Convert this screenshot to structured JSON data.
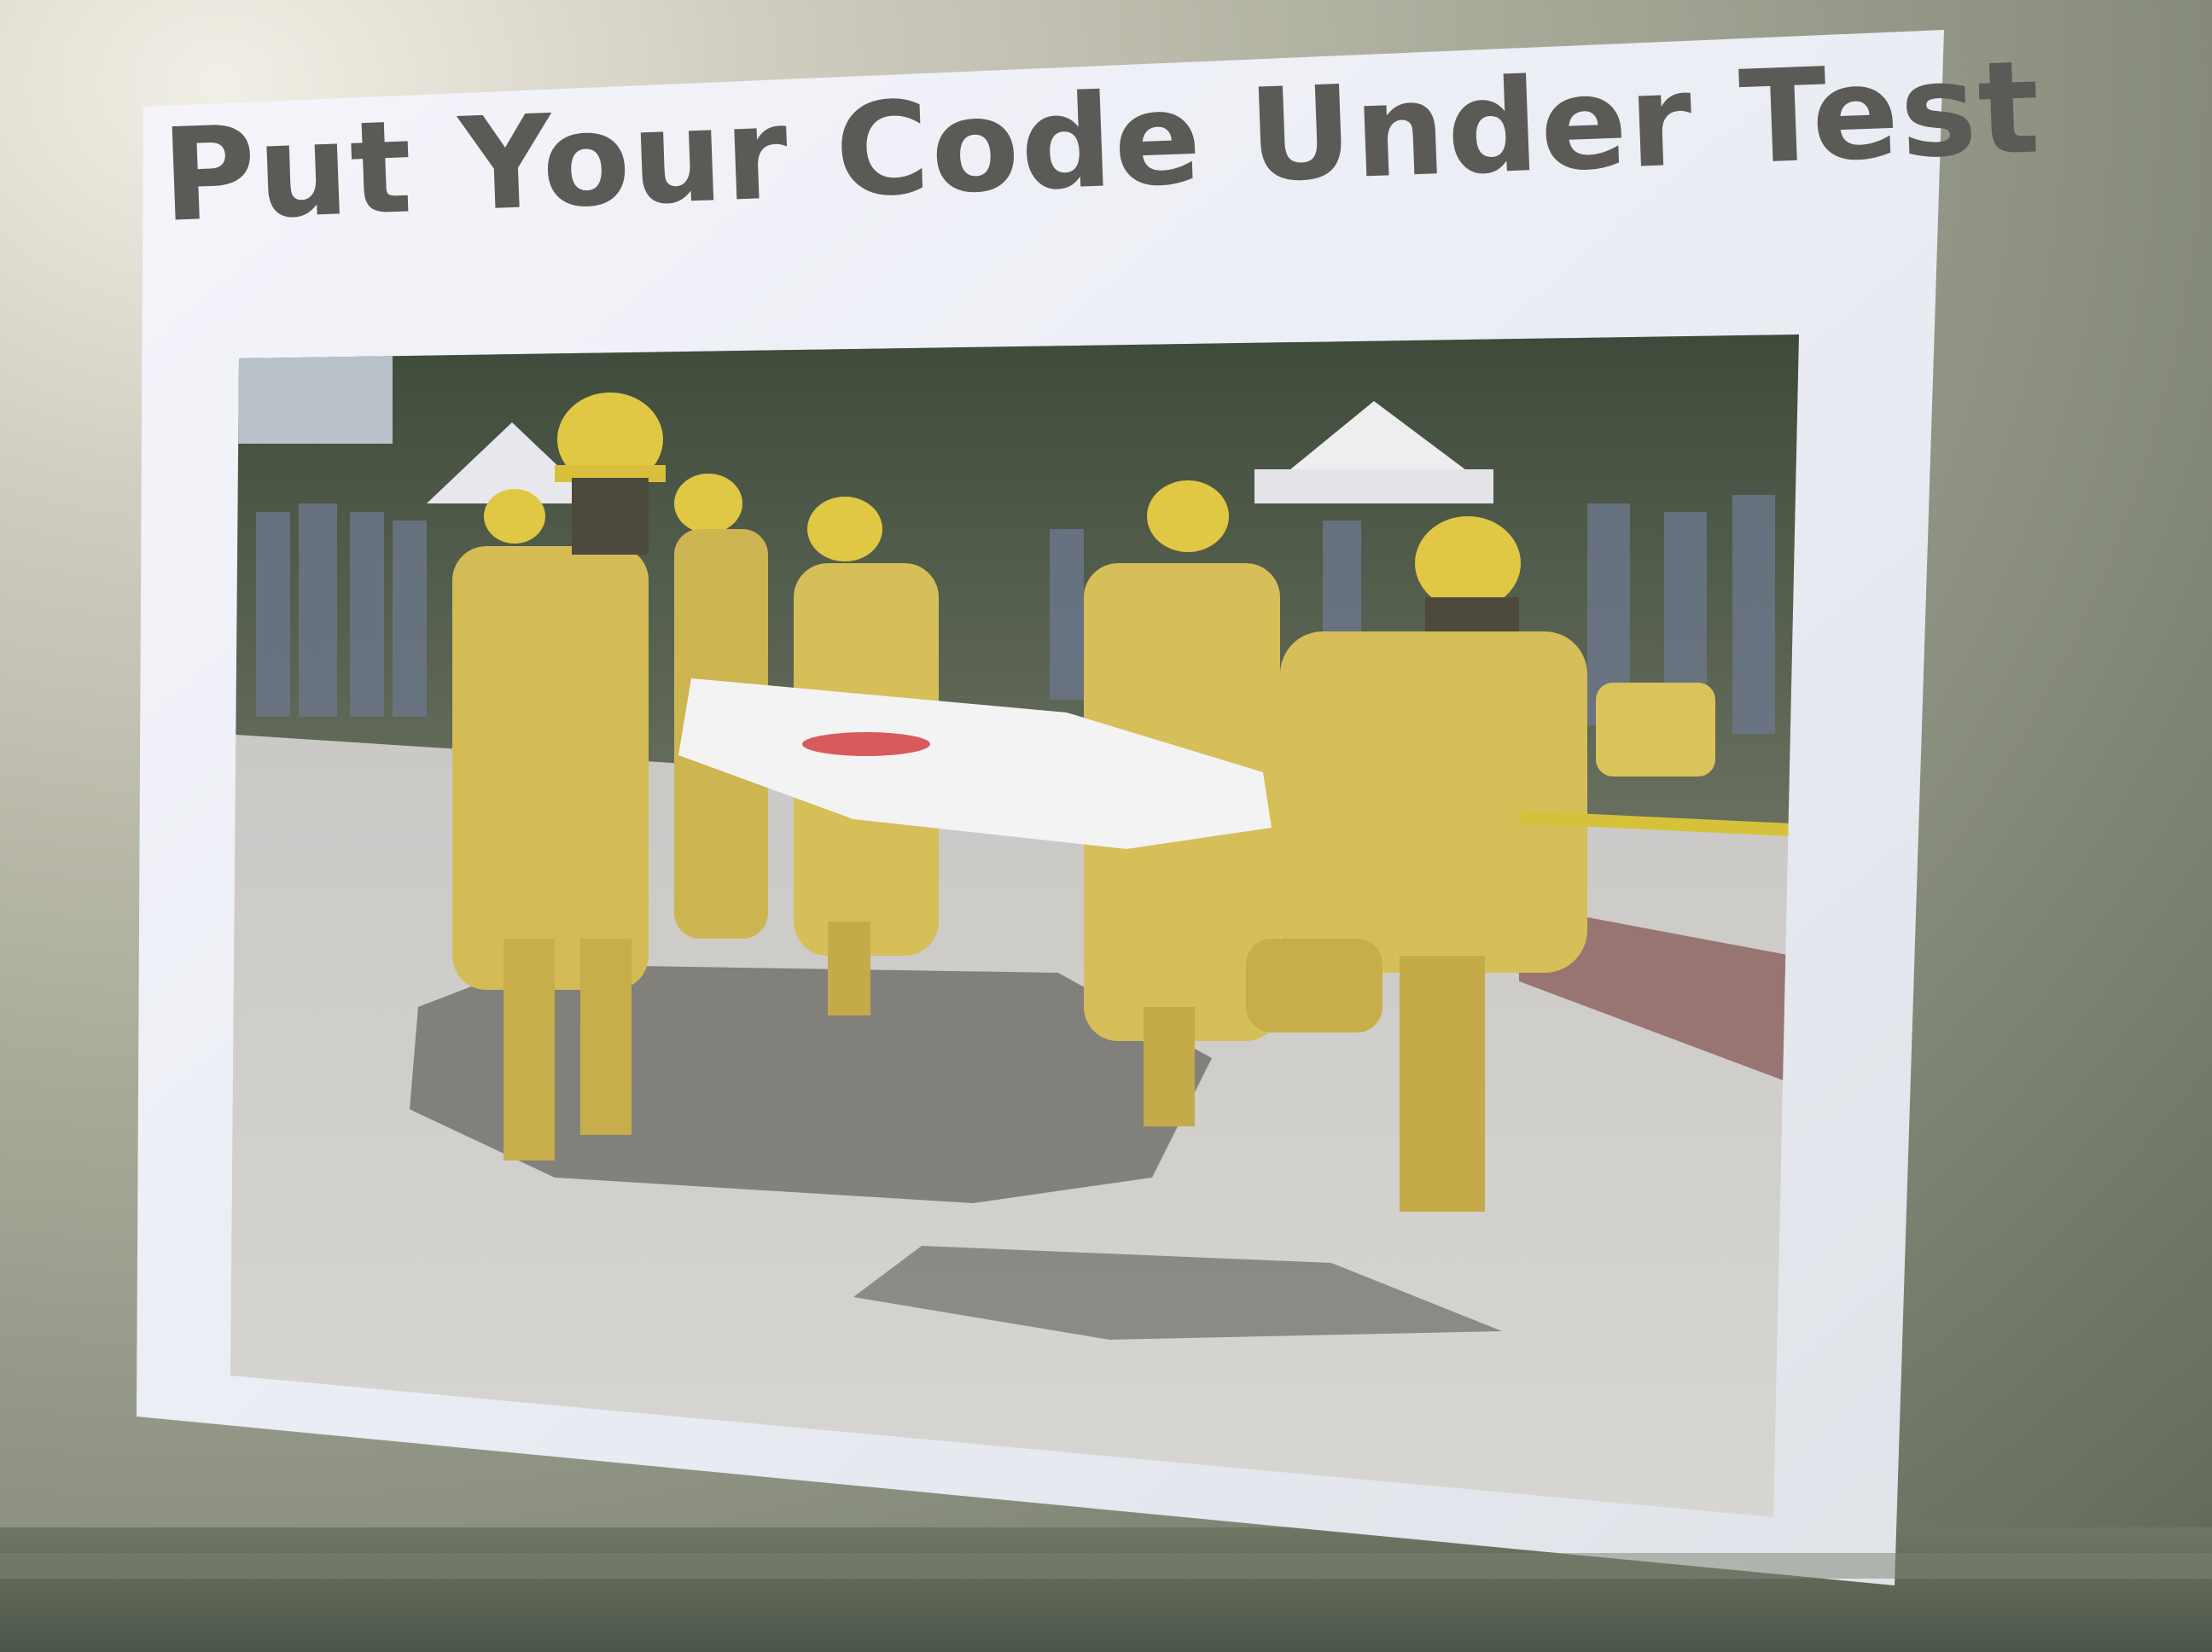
{
  "slide": {
    "title": "Put Your Code Under Test"
  },
  "photo": {
    "description_icon": "firefighters-carrying-board-photo",
    "colors": {
      "slide_bg": "#eef0f6",
      "photo_ground": "#c9c7c4",
      "gear_yellow": "#d9c35a",
      "helmet_yellow": "#e2cc48",
      "board": "#f2f2f2",
      "target_red": "#d85a5a"
    }
  }
}
